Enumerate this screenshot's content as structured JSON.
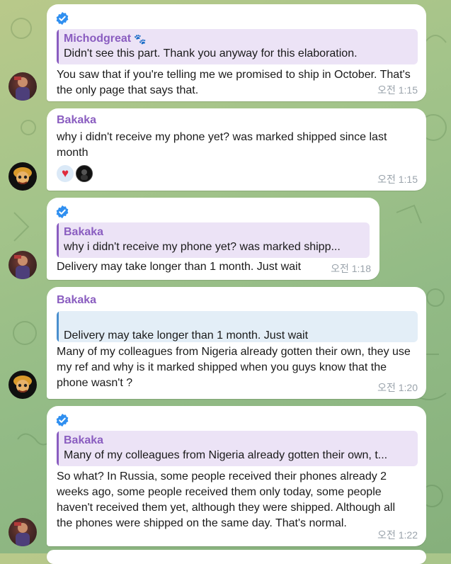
{
  "messages": [
    {
      "quote_author": "Michodgreat",
      "quote_text": "Didn't see this part.  Thank you anyway for this elaboration.",
      "text": "You saw that if you're telling me we promised to ship in October. That's the only page that says that.",
      "time": "오전 1:15"
    },
    {
      "sender": "Bakaka",
      "text": "why i didn't receive my phone  yet?  was marked shipped since last month",
      "reactions": [
        "heart",
        "user-avatar"
      ],
      "time": "오전 1:15"
    },
    {
      "quote_author": "Bakaka",
      "quote_text": "why i didn't receive my phone  yet?  was marked shipp...",
      "text": "Delivery may take longer than 1 month. Just wait",
      "time": "오전 1:18"
    },
    {
      "sender": "Bakaka",
      "quote_text": "Delivery may take longer than 1 month. Just wait",
      "text": "Many of my colleagues from Nigeria already gotten their own, they use my ref and why is it marked shipped when you guys know that the phone wasn't ?",
      "time": "오전 1:20"
    },
    {
      "quote_author": "Bakaka",
      "quote_text": "Many of my colleagues from Nigeria already gotten their own, t...",
      "text": "So what? In Russia, some people received their phones already 2 weeks ago, some people received them only today, some people haven't received them yet, although they were shipped.  Although all the phones were shipped on the same day.   That's normal.",
      "time": "오전 1:22"
    }
  ],
  "colors": {
    "accent_purple": "#8a5dc0",
    "quote_blue": "#4a8fce",
    "verified_blue": "#2f8ff0"
  }
}
